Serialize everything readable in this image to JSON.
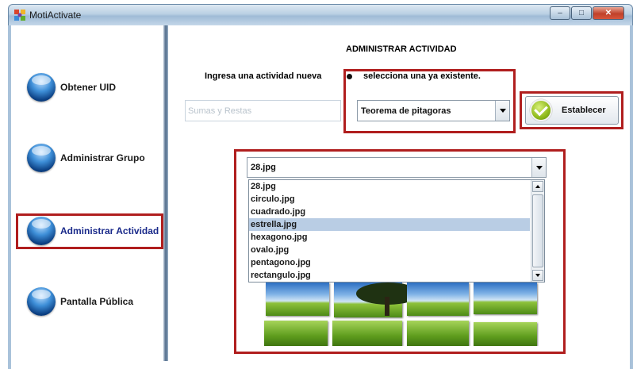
{
  "window": {
    "title": "MotiActivate",
    "controls": {
      "minimize": "–",
      "maximize": "□",
      "close": "✕"
    }
  },
  "sidebar": {
    "items": [
      {
        "label": "Obtener UID",
        "active": false
      },
      {
        "label": "Administrar Grupo",
        "active": false
      },
      {
        "label": "Administrar Actividad",
        "active": true
      },
      {
        "label": "Pantalla Pública",
        "active": false
      }
    ]
  },
  "main": {
    "title": "ADMINISTRAR ACTIVIDAD",
    "new_activity_label": "Ingresa una actividad nueva",
    "new_activity_value": "",
    "new_activity_placeholder": "Sumas y Restas",
    "existing_label": "selecciona una ya existente.",
    "existing_selected": "Teorema de pitagoras",
    "set_button": "Establecer"
  },
  "image_selector": {
    "selected": "28.jpg",
    "options": [
      "28.jpg",
      "circulo.jpg",
      "cuadrado.jpg",
      "estrella.jpg",
      "hexagono.jpg",
      "ovalo.jpg",
      "pentagono.jpg",
      "rectangulo.jpg"
    ],
    "highlighted": "estrella.jpg"
  },
  "colors": {
    "highlight_border": "#b01e1e",
    "selection_bg": "#b9cde4",
    "active_nav_text": "#1a2a8a"
  }
}
